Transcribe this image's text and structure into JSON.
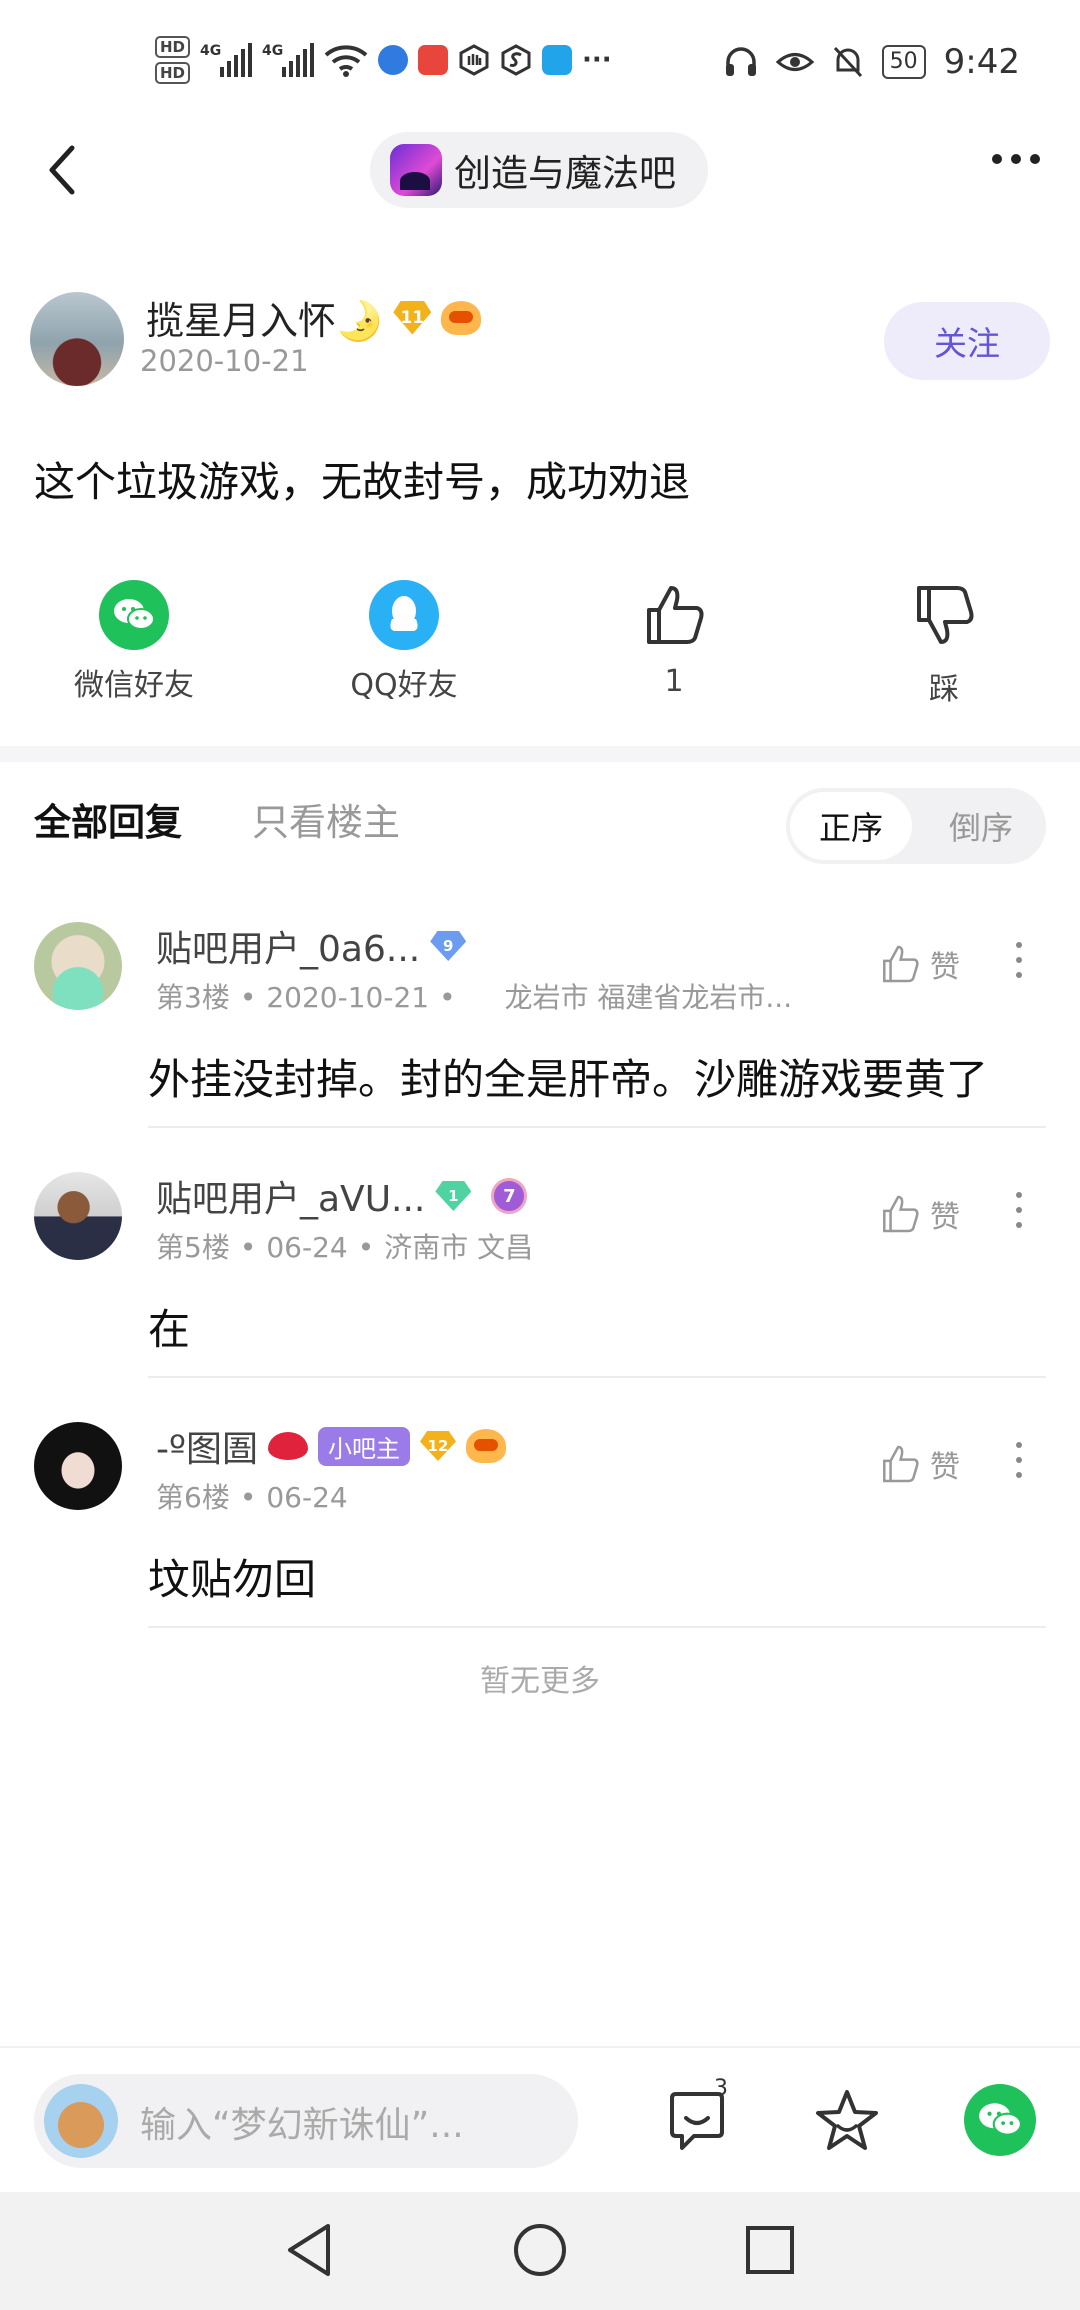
{
  "status_bar": {
    "time": "9:42",
    "battery": "50",
    "signal_1": "4G",
    "signal_2": "4G",
    "hd_1": "HD",
    "hd_2": "HD",
    "overflow": "···"
  },
  "header": {
    "forum_name": "创造与魔法吧"
  },
  "post": {
    "author": "揽星月入怀🌛",
    "level": "11",
    "date": "2020-10-21",
    "follow_label": "关注",
    "text": "这个垃圾游戏，无故封号，成功劝退"
  },
  "share": {
    "wechat_label": "微信好友",
    "qq_label": "QQ好友",
    "like_count": "1",
    "dislike_label": "踩"
  },
  "tabs": {
    "all_replies": "全部回复",
    "owner_only": "只看楼主",
    "sort_asc": "正序",
    "sort_desc": "倒序"
  },
  "replies": [
    {
      "username": "贴吧用户_0a6...",
      "level": "9",
      "floor": "第3楼",
      "date": "2020-10-21",
      "location": "龙岩市 福建省龙岩市...",
      "like_label": "赞",
      "content": "外挂没封掉。封的全是肝帝。沙雕游戏要黄了"
    },
    {
      "username": "贴吧用户_aVU...",
      "level": "1",
      "medal": "7",
      "floor": "第5楼",
      "date": "06-24",
      "location": "济南市 文昌",
      "like_label": "赞",
      "content": "在"
    },
    {
      "username": "-º图圄",
      "tag": "小吧主",
      "level": "12",
      "floor": "第6楼",
      "date": "06-24",
      "like_label": "赞",
      "content": "坟贴勿回"
    }
  ],
  "footer_note": "暂无更多",
  "bottom_bar": {
    "input_placeholder": "输入“梦幻新诛仙”...",
    "comment_count": "3"
  },
  "colors": {
    "accent_purple": "#6455d8",
    "wechat_green": "#1fc15a",
    "qq_blue": "#2ab0f5"
  }
}
